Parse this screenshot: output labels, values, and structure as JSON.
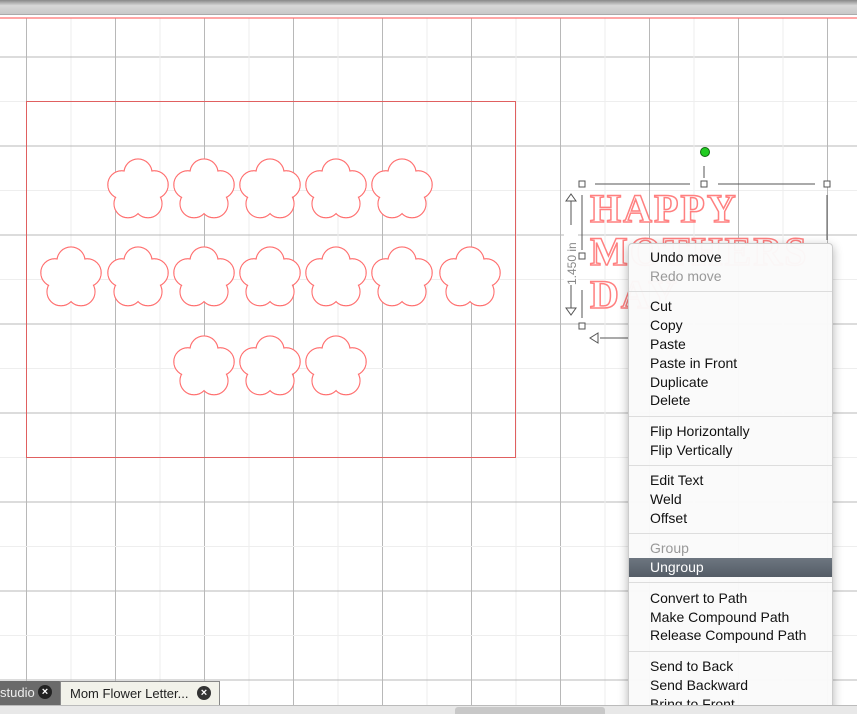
{
  "canvas": {
    "design_text": [
      "HAPPY",
      "MOTHERS",
      "DAY"
    ],
    "dimension_label": "1.450 in",
    "cut_color": "#ff6b6b",
    "handle_color": "#22cc22"
  },
  "context_menu": {
    "groups": [
      [
        {
          "label": "Undo move",
          "enabled": true
        },
        {
          "label": "Redo move",
          "enabled": false
        }
      ],
      [
        {
          "label": "Cut",
          "enabled": true
        },
        {
          "label": "Copy",
          "enabled": true
        },
        {
          "label": "Paste",
          "enabled": true
        },
        {
          "label": "Paste in Front",
          "enabled": true
        },
        {
          "label": "Duplicate",
          "enabled": true
        },
        {
          "label": "Delete",
          "enabled": true
        }
      ],
      [
        {
          "label": "Flip Horizontally",
          "enabled": true
        },
        {
          "label": "Flip Vertically",
          "enabled": true
        }
      ],
      [
        {
          "label": "Edit Text",
          "enabled": true
        },
        {
          "label": "Weld",
          "enabled": true
        },
        {
          "label": "Offset",
          "enabled": true
        }
      ],
      [
        {
          "label": "Group",
          "enabled": false
        },
        {
          "label": "Ungroup",
          "enabled": true,
          "highlighted": true
        }
      ],
      [
        {
          "label": "Convert to Path",
          "enabled": true
        },
        {
          "label": "Make Compound Path",
          "enabled": true
        },
        {
          "label": "Release Compound Path",
          "enabled": true
        }
      ],
      [
        {
          "label": "Send to Back",
          "enabled": true
        },
        {
          "label": "Send Backward",
          "enabled": true
        },
        {
          "label": "Bring to Front",
          "enabled": true
        }
      ]
    ]
  },
  "tabs": [
    {
      "label": "studio",
      "icon": "close-icon"
    },
    {
      "label": "Mom Flower Letter...",
      "icon": "close-icon",
      "active": true
    }
  ]
}
